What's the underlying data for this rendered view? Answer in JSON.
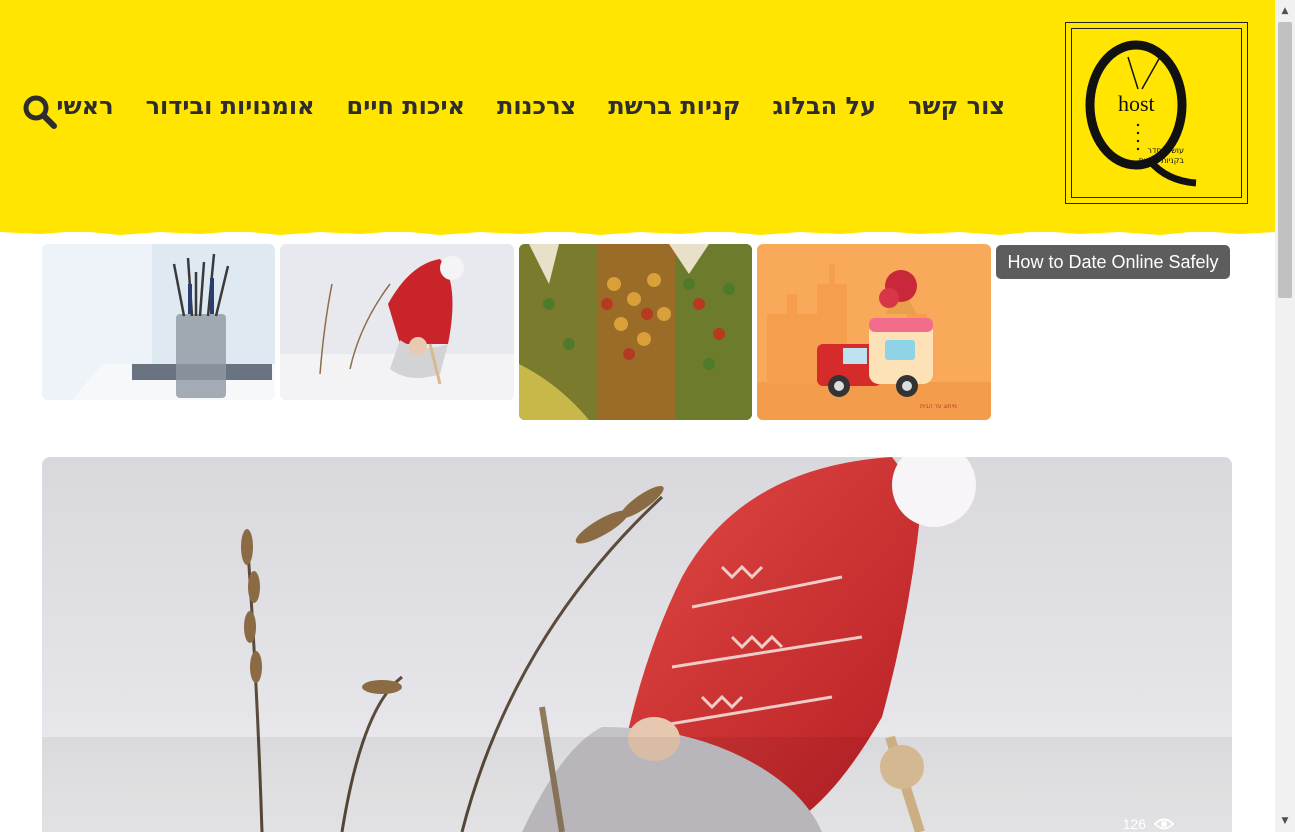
{
  "header": {
    "background": "#ffe500",
    "logo": {
      "big_letter": "Q",
      "word": "host",
      "tagline_line1": "עושים סדר",
      "tagline_line2": "בקניות ברשת"
    },
    "nav": [
      {
        "label": "ראשי"
      },
      {
        "label": "אומנויות ובידור"
      },
      {
        "label": "איכות חיים"
      },
      {
        "label": "צרכנות"
      },
      {
        "label": "קניות ברשת"
      },
      {
        "label": "על הבלוג"
      },
      {
        "label": "צור קשר"
      }
    ],
    "search_icon": "search-icon"
  },
  "featured": {
    "tag_label": "How to Date Online Safely",
    "thumbs": [
      {
        "subject": "ice-cream truck illustration"
      },
      {
        "subject": "colorful pasta bags"
      },
      {
        "subject": "gnome in snow"
      },
      {
        "subject": "paint brushes in cup"
      }
    ]
  },
  "hero": {
    "subject": "gnome with red knitted hat in snow",
    "views": "126",
    "views_icon": "eye-icon"
  },
  "colors": {
    "accent": "#ffe500",
    "nav_text": "#2d2d2d",
    "tag_bg": "#5d5d5d"
  }
}
